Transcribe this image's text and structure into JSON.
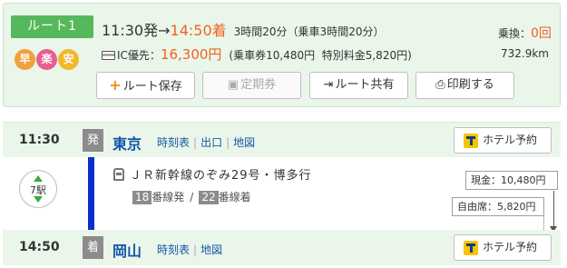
{
  "route": {
    "label": "ルート1",
    "badges": [
      "早",
      "楽",
      "安"
    ],
    "dep_time": "11:30発",
    "arrow": "→",
    "arr_time": "14:50着",
    "duration": "3時間20分（乗車3時間20分）",
    "transfer_label": "乗換：",
    "transfer_count": "0回",
    "ic_label": "IC優先：",
    "fare_total": "16,300円",
    "fare_ticket": "(乗車券10,480円",
    "fare_express": "特別料金5,820円)",
    "distance": "732.9km"
  },
  "buttons": {
    "save": "ルート保存",
    "teiki": "定期券",
    "share": "ルート共有",
    "print": "印刷する"
  },
  "departure": {
    "time": "11:30",
    "mark": "発",
    "station": "東京",
    "links": [
      "時刻表",
      "出口",
      "地図"
    ],
    "hotel": "ホテル予約"
  },
  "segment": {
    "stops": "7駅",
    "train": "ＪＲ新幹線のぞみ29号・博多行",
    "dep_track_num": "18",
    "dep_track_label": "番線発",
    "slash": "/",
    "arr_track_num": "22",
    "arr_track_label": "番線着",
    "fare_cash": "現金：10,480円",
    "fare_seat": "自由席：5,820円"
  },
  "arrival": {
    "time": "14:50",
    "mark": "着",
    "station": "岡山",
    "links": [
      "時刻表",
      "地図"
    ],
    "hotel": "ホテル予約"
  },
  "colors": {
    "accent_green": "#55b85c",
    "highlight_orange": "#f26222",
    "link_blue": "#1457a8",
    "line_blue": "#0b2ecf"
  }
}
